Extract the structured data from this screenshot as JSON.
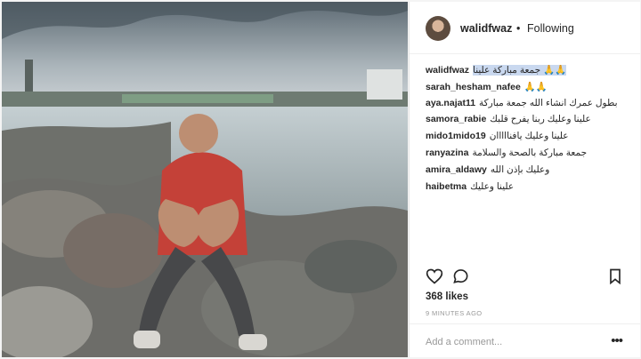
{
  "post": {
    "username": "walidfwaz",
    "separator": "•",
    "follow_status": "Following",
    "comments": [
      {
        "user": "walidfwaz",
        "text": "جمعة مباركة علينا 🙏🙏",
        "highlight": true
      },
      {
        "user": "sarah_hesham_nafee",
        "text": "🙏🙏"
      },
      {
        "user": "aya.najat11",
        "text": "بطول عمرك انشاء الله جمعة مباركة"
      },
      {
        "user": "samora_rabie",
        "text": "علينا وعليك ربنا يفرح قلبك"
      },
      {
        "user": "mido1mido19",
        "text": "علينا وعليك يافنااااان"
      },
      {
        "user": "ranyazina",
        "text": "جمعة مباركة بالصحة والسلامة"
      },
      {
        "user": "amira_aldawy",
        "text": "وعليك بإذن الله"
      },
      {
        "user": "haibetma",
        "text": "علينا وعليك"
      }
    ],
    "likes": "368 likes",
    "time": "9 MINUTES AGO",
    "add_comment_placeholder": "Add a comment...",
    "more_label": "•••"
  },
  "icons": {
    "like": "heart-icon",
    "comment": "comment-bubble-icon",
    "save": "bookmark-icon"
  }
}
